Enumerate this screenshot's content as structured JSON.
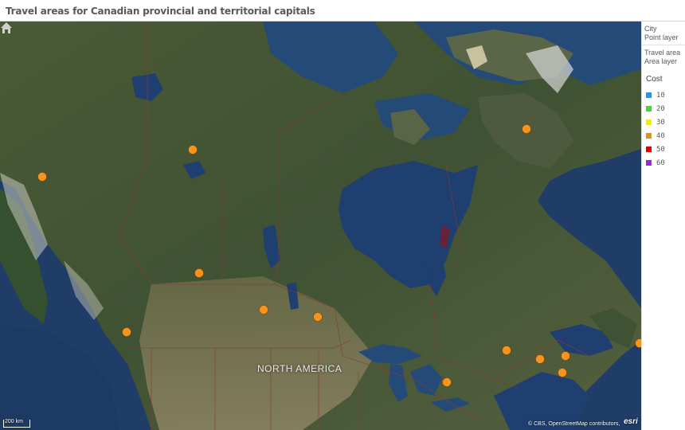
{
  "title": "Travel areas for Canadian provincial and territorial capitals",
  "map": {
    "region_label": "NORTH AMERICA",
    "scale_label": "200 km",
    "attribution": "© CBS, OpenStreetMap contributors,",
    "esri_label": "esri",
    "marker_color": "#f7941d",
    "marker_count": 13
  },
  "legend": {
    "point_layer": {
      "line1": "City",
      "line2": "Point layer"
    },
    "area_layer": {
      "line1": "Travel area",
      "line2": "Area layer"
    },
    "heading": "Cost",
    "items": [
      {
        "value": "10",
        "color": "#2196f3"
      },
      {
        "value": "20",
        "color": "#3ddc2e"
      },
      {
        "value": "30",
        "color": "#f0f000"
      },
      {
        "value": "40",
        "color": "#f28c00"
      },
      {
        "value": "50",
        "color": "#e60000"
      },
      {
        "value": "60",
        "color": "#a020f0"
      }
    ]
  }
}
